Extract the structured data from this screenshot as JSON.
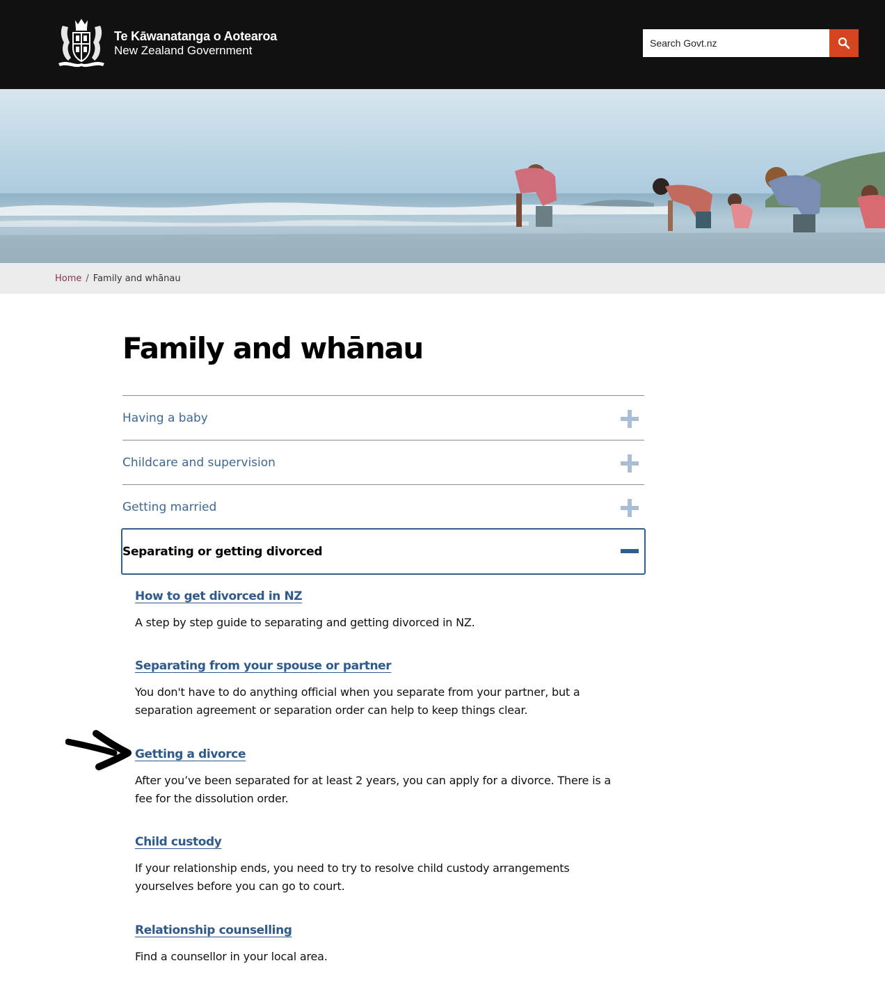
{
  "header": {
    "logo_maori": "Te Kāwanatanga o Aotearoa",
    "logo_english": "New Zealand Government",
    "search_placeholder": "Search Govt.nz",
    "search_button_color": "#d5451f"
  },
  "breadcrumb": {
    "home": "Home",
    "separator": "/",
    "current": "Family and whānau"
  },
  "page": {
    "title": "Family and whānau"
  },
  "accordion": {
    "items": [
      {
        "label": "Having a baby",
        "expanded": false
      },
      {
        "label": "Childcare and supervision",
        "expanded": false
      },
      {
        "label": "Getting married",
        "expanded": false
      }
    ],
    "open_item": {
      "label": "Separating or getting divorced",
      "expanded": true,
      "children": [
        {
          "title": "How to get divorced in NZ",
          "description": "A step by step guide to separating and getting divorced in NZ."
        },
        {
          "title": "Separating from your spouse or partner",
          "description": "You don't have to do anything official when you separate from your partner, but a separation agreement or separation order can help to keep things clear."
        },
        {
          "title": "Getting a divorce",
          "description": "After you’ve been separated for at least 2 years, you can apply for a divorce. There is a fee for the dissolution order."
        },
        {
          "title": "Child custody",
          "description": "If your relationship ends, you need to try to resolve child custody arrangements yourselves before you can go to court."
        },
        {
          "title": "Relationship counselling",
          "description": "Find a counsellor in your local area."
        }
      ]
    }
  },
  "colors": {
    "header_bg": "#111111",
    "link": "#2f5a8a",
    "accordion_label": "#3c6893",
    "plus_icon": "#a9bdd3",
    "breadcrumb_bg": "#ebebeb",
    "breadcrumb_home": "#8a2f55"
  }
}
